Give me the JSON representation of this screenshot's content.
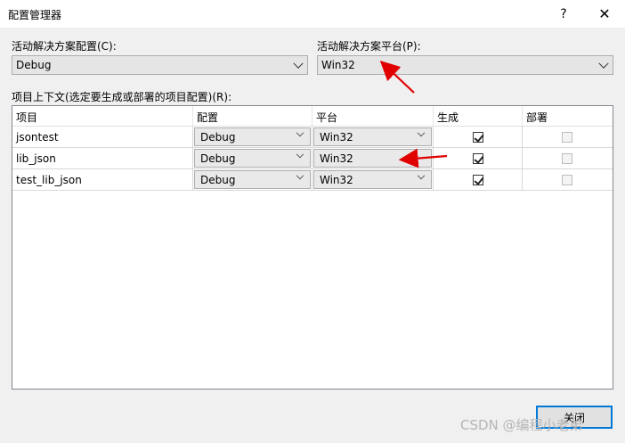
{
  "window": {
    "title": "配置管理器",
    "help": "?",
    "close": "✕"
  },
  "solution": {
    "config_label": "活动解决方案配置(C):",
    "config_value": "Debug",
    "platform_label": "活动解决方案平台(P):",
    "platform_value": "Win32"
  },
  "contexts": {
    "label": "项目上下文(选定要生成或部署的项目配置)(R):",
    "columns": [
      "项目",
      "配置",
      "平台",
      "生成",
      "部署"
    ],
    "rows": [
      {
        "project": "jsontest",
        "config": "Debug",
        "platform": "Win32",
        "build": true,
        "deploy": false
      },
      {
        "project": "lib_json",
        "config": "Debug",
        "platform": "Win32",
        "build": true,
        "deploy": false
      },
      {
        "project": "test_lib_json",
        "config": "Debug",
        "platform": "Win32",
        "build": true,
        "deploy": false
      }
    ]
  },
  "buttons": {
    "close": "关闭"
  },
  "watermark": "CSDN @编程小老弟",
  "colors": {
    "annotation_arrow": "#e00000",
    "accent": "#0078d7"
  }
}
